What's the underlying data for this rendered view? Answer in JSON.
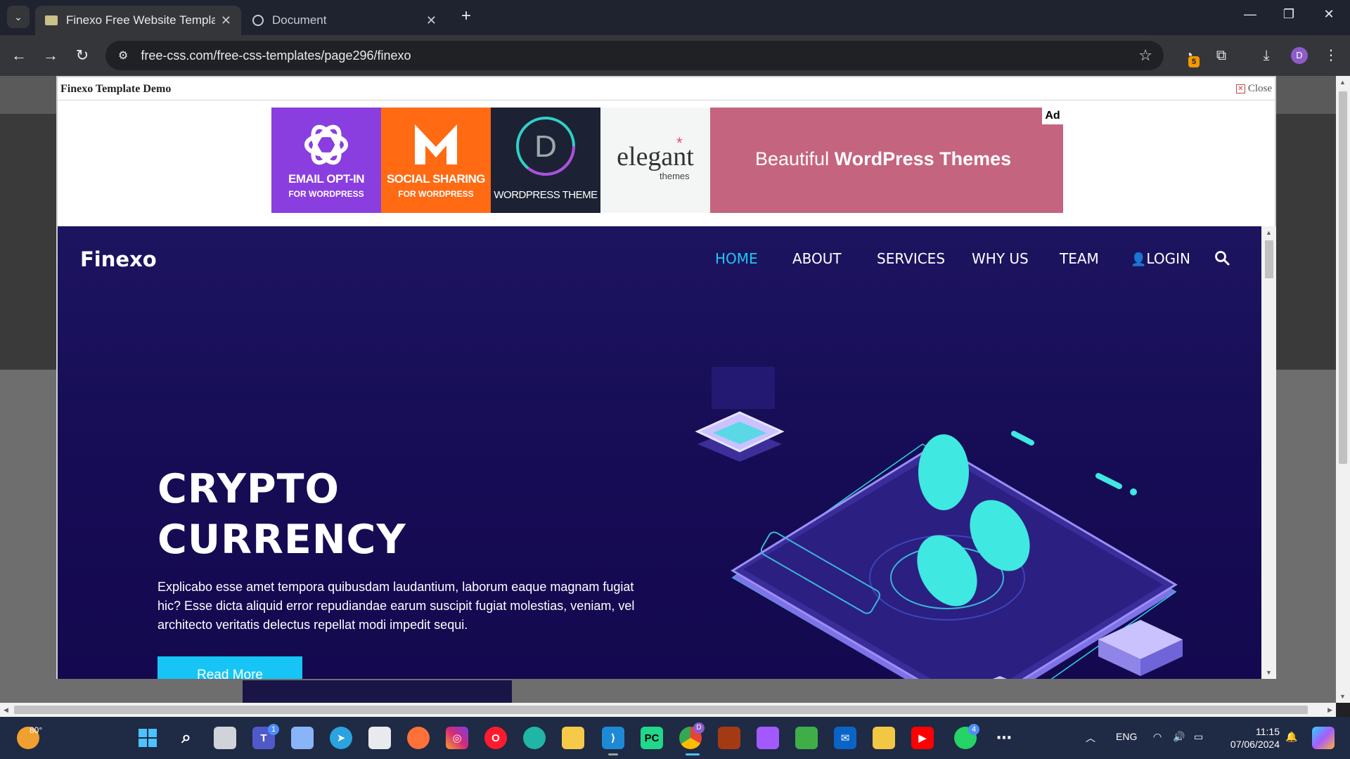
{
  "browser": {
    "tabs": [
      {
        "title": "Finexo Free Website Template |",
        "active": true
      },
      {
        "title": "Document",
        "active": false
      }
    ],
    "address": "free-css.com/free-css-templates/page296/finexo",
    "extension_badge": "5",
    "profile_initial": "D"
  },
  "modal": {
    "title": "Finexo Template Demo",
    "close_label": "Close"
  },
  "ad": {
    "label": "Ad",
    "tiles": [
      {
        "big": "EMAIL OPT-IN",
        "small": "FOR WORDPRESS",
        "color": "#8a3ee0"
      },
      {
        "big": "SOCIAL SHARING",
        "small": "FOR WORDPRESS",
        "color": "#ff6a13"
      },
      {
        "big": "WORDPRESS THEME",
        "small": "",
        "color": "#1c2233"
      },
      {
        "big": "elegant",
        "small": "themes",
        "color": "#f4f6f6"
      }
    ],
    "headline_light": "Beautiful",
    "headline_bold": "WordPress Themes",
    "color": "#c5647f"
  },
  "site": {
    "brand": "Finexo",
    "nav": [
      "HOME",
      "ABOUT",
      "SERVICES",
      "WHY US",
      "TEAM",
      "LOGIN"
    ],
    "active_nav": "HOME",
    "hero_title_line1": "CRYPTO",
    "hero_title_line2": "CURRENCY",
    "hero_text": "Explicabo esse amet tempora quibusdam laudantium, laborum eaque magnam fugiat hic? Esse dicta aliquid error repudiandae earum suscipit fugiat molestias, veniam, vel architecto veritatis delectus repellat modi impedit sequi.",
    "cta_label": "Read More",
    "accent": "#1ec8f2"
  },
  "taskbar": {
    "temperature": "80°",
    "language": "ENG",
    "time": "11:15",
    "date": "07/06/2024",
    "teams_badge": "1",
    "chrome_badge": "D",
    "whatsapp_badge": "4"
  }
}
